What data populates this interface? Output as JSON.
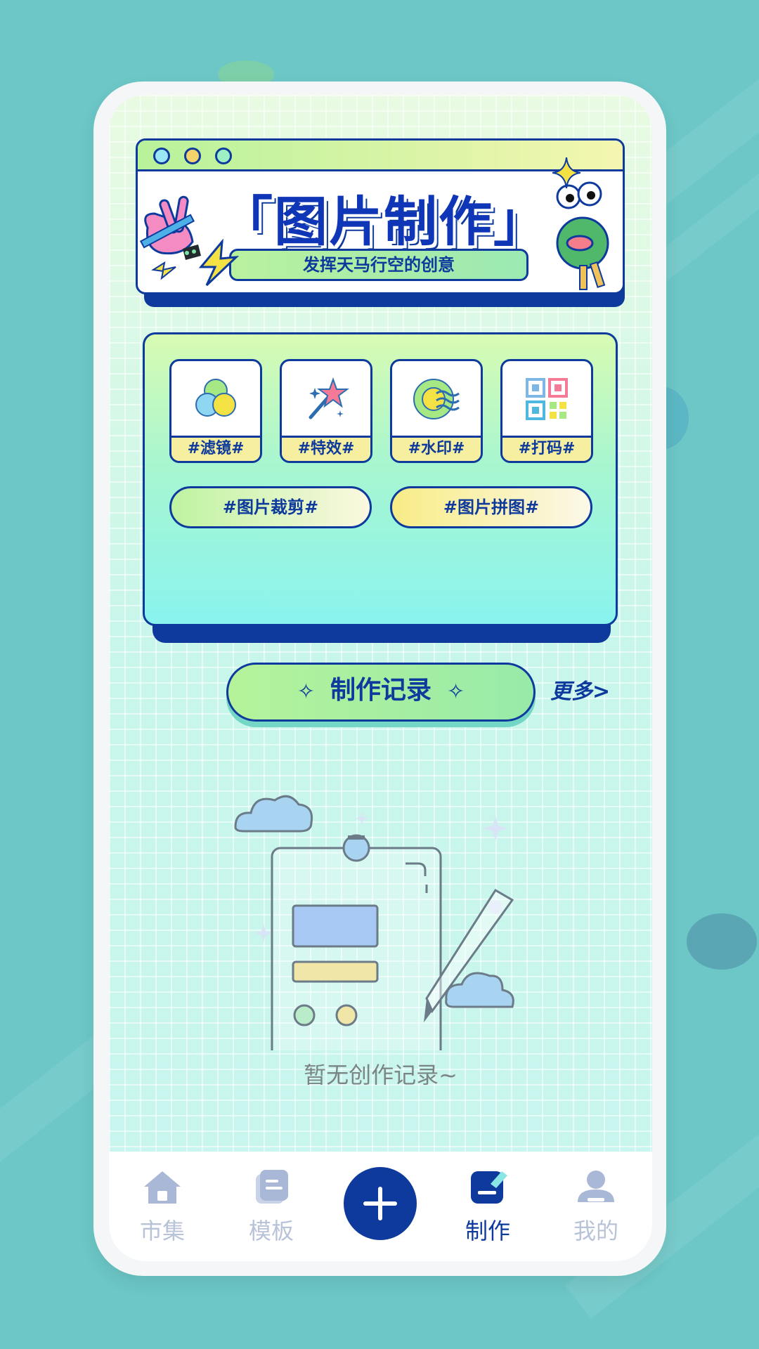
{
  "banner": {
    "title": "「图片制作」",
    "subtitle": "发挥天马行空的创意"
  },
  "tools": {
    "items": [
      {
        "label": "#滤镜#",
        "icon": "filter-icon"
      },
      {
        "label": "#特效#",
        "icon": "magic-wand-icon"
      },
      {
        "label": "#水印#",
        "icon": "watermark-icon"
      },
      {
        "label": "#打码#",
        "icon": "qr-code-icon"
      }
    ],
    "pills": [
      {
        "label": "#图片裁剪#"
      },
      {
        "label": "#图片拼图#"
      }
    ]
  },
  "records": {
    "title": "制作记录",
    "more": "更多>",
    "empty_text": "暂无创作记录~"
  },
  "tabbar": {
    "items": [
      {
        "label": "市集",
        "icon": "home-icon",
        "active": false
      },
      {
        "label": "模板",
        "icon": "template-icon",
        "active": false
      },
      {
        "label": "",
        "icon": "plus-icon",
        "active": false
      },
      {
        "label": "制作",
        "icon": "edit-icon",
        "active": true
      },
      {
        "label": "我的",
        "icon": "user-icon",
        "active": false
      }
    ]
  },
  "colors": {
    "primary": "#0d3a9c",
    "background": "#6cc7c6",
    "inactive_tab": "#b8c3d8",
    "label_yellow": "#f5ef9f"
  }
}
